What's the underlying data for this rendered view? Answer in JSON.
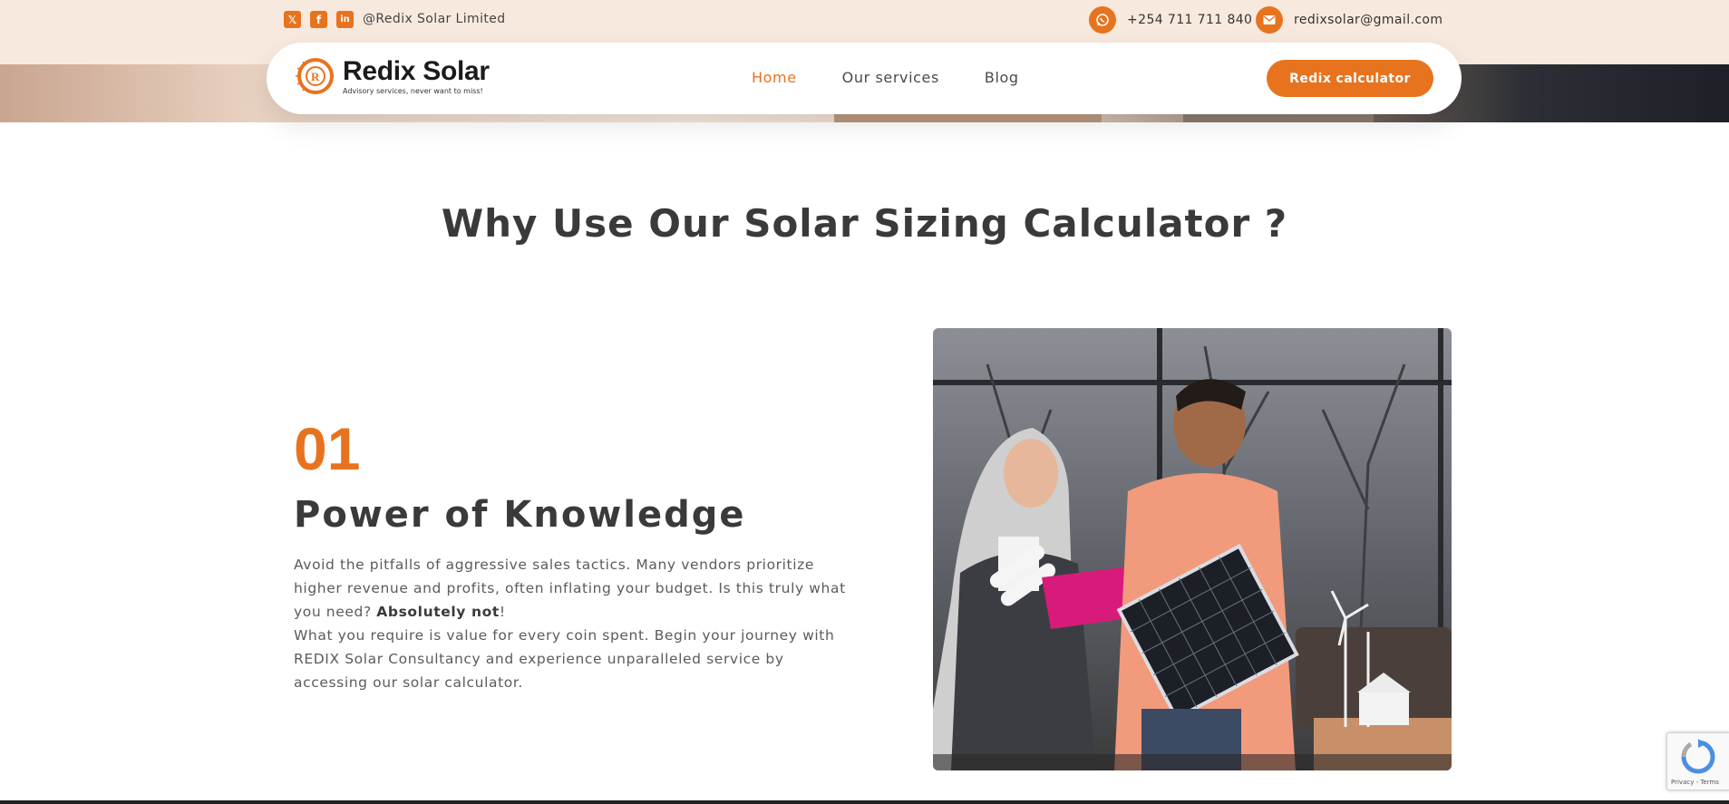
{
  "topbar": {
    "social": [
      {
        "icon": "x-twitter-icon",
        "glyph": "𝕏"
      },
      {
        "icon": "facebook-icon",
        "glyph": "f"
      },
      {
        "icon": "linkedin-icon",
        "glyph": "in"
      }
    ],
    "handle": "@Redix Solar Limited",
    "phone": "+254 711 711 840",
    "phone_icon": "whatsapp-icon",
    "email": "redixsolar@gmail.com",
    "email_icon": "envelope-icon"
  },
  "header": {
    "brand_name": "Redix Solar",
    "brand_tagline": "Advisory services, never want to miss!",
    "nav": [
      {
        "label": "Home",
        "active": true
      },
      {
        "label": "Our services",
        "active": false
      },
      {
        "label": "Blog",
        "active": false
      }
    ],
    "cta_label": "Redix calculator"
  },
  "main": {
    "section_title": "Why Use Our Solar Sizing Calculator ?",
    "feature": {
      "number": "01",
      "title": "Power of Knowledge",
      "paragraph1_before": "Avoid the pitfalls of aggressive sales tactics. Many vendors prioritize higher revenue and profits, often inflating your budget. Is this truly what you need? ",
      "paragraph1_bold": "Absolutely not",
      "paragraph1_after": "!",
      "paragraph2": "What you require is value for every coin spent. Begin your journey with REDIX Solar Consultancy and experience unparalleled service by accessing our solar calculator."
    }
  },
  "recaptcha": {
    "text": "Privacy - Terms"
  },
  "colors": {
    "accent": "#e8731f",
    "topbar_bg": "#f8e9de",
    "heading": "#3a3a3a"
  }
}
